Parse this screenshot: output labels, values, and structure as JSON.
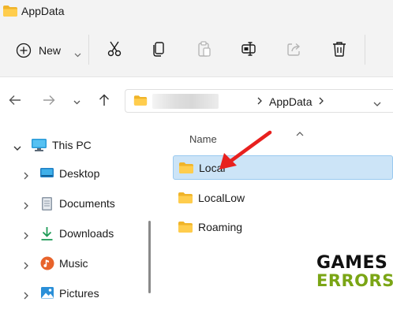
{
  "window": {
    "title": "AppData"
  },
  "toolbar": {
    "new_label": "New",
    "actions": [
      "cut-icon",
      "copy-icon",
      "paste-icon",
      "rename-icon",
      "share-icon",
      "delete-icon"
    ]
  },
  "address": {
    "crumbs": [
      "AppData"
    ]
  },
  "sidebar": {
    "items": [
      {
        "label": "This PC",
        "icon": "this-pc-icon",
        "expanded": true
      },
      {
        "label": "Desktop",
        "icon": "desktop-icon"
      },
      {
        "label": "Documents",
        "icon": "documents-icon"
      },
      {
        "label": "Downloads",
        "icon": "downloads-icon"
      },
      {
        "label": "Music",
        "icon": "music-icon"
      },
      {
        "label": "Pictures",
        "icon": "pictures-icon"
      }
    ]
  },
  "content": {
    "column_name": "Name",
    "files": [
      {
        "name": "Local",
        "selected": true
      },
      {
        "name": "LocalLow",
        "selected": false
      },
      {
        "name": "Roaming",
        "selected": false
      }
    ]
  },
  "watermark": {
    "line1": "GAMES",
    "line2": "ERRORS"
  },
  "colors": {
    "selection": "#cce4f7",
    "folder": "#f5c542",
    "annotation_arrow": "#e8201e",
    "watermark_green": "#7aa515"
  }
}
